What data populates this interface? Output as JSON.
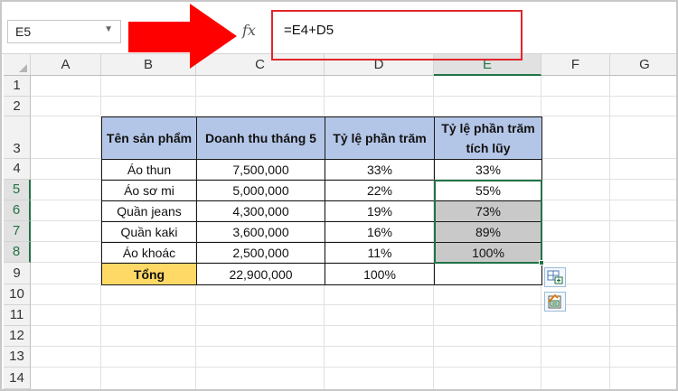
{
  "name_box": {
    "value": "E5"
  },
  "formula_bar": {
    "fx_label": "fx",
    "formula": "=E4+D5"
  },
  "columns": [
    "A",
    "B",
    "C",
    "D",
    "E",
    "F",
    "G"
  ],
  "rows": [
    "1",
    "2",
    "3",
    "4",
    "5",
    "6",
    "7",
    "8",
    "9",
    "10",
    "11",
    "12",
    "13",
    "14"
  ],
  "table": {
    "headers": [
      "Tên sản phẩm",
      "Doanh thu tháng 5",
      "Tỷ lệ phần trăm",
      "Tỷ lệ phần trăm tích lũy"
    ],
    "rows": [
      [
        "Áo thun",
        "7,500,000",
        "33%",
        "33%"
      ],
      [
        "Áo sơ mi",
        "5,000,000",
        "22%",
        "55%"
      ],
      [
        "Quần jeans",
        "4,300,000",
        "19%",
        "73%"
      ],
      [
        "Quần kaki",
        "3,600,000",
        "16%",
        "89%"
      ],
      [
        "Áo khoác",
        "2,500,000",
        "11%",
        "100%"
      ]
    ],
    "total": [
      "Tổng",
      "22,900,000",
      "100%",
      ""
    ]
  },
  "colors": {
    "selection": "#217346",
    "header_fill": "#b4c6e7",
    "total_fill": "#ffd966",
    "filled_cells": "#c9c9c9",
    "arrow": "#ff0000",
    "highlight_box": "#e0262b"
  },
  "icons": [
    "chevron-down-icon",
    "fx-icon",
    "red-arrow-icon",
    "quick-analysis-icon",
    "paste-options-icon"
  ]
}
